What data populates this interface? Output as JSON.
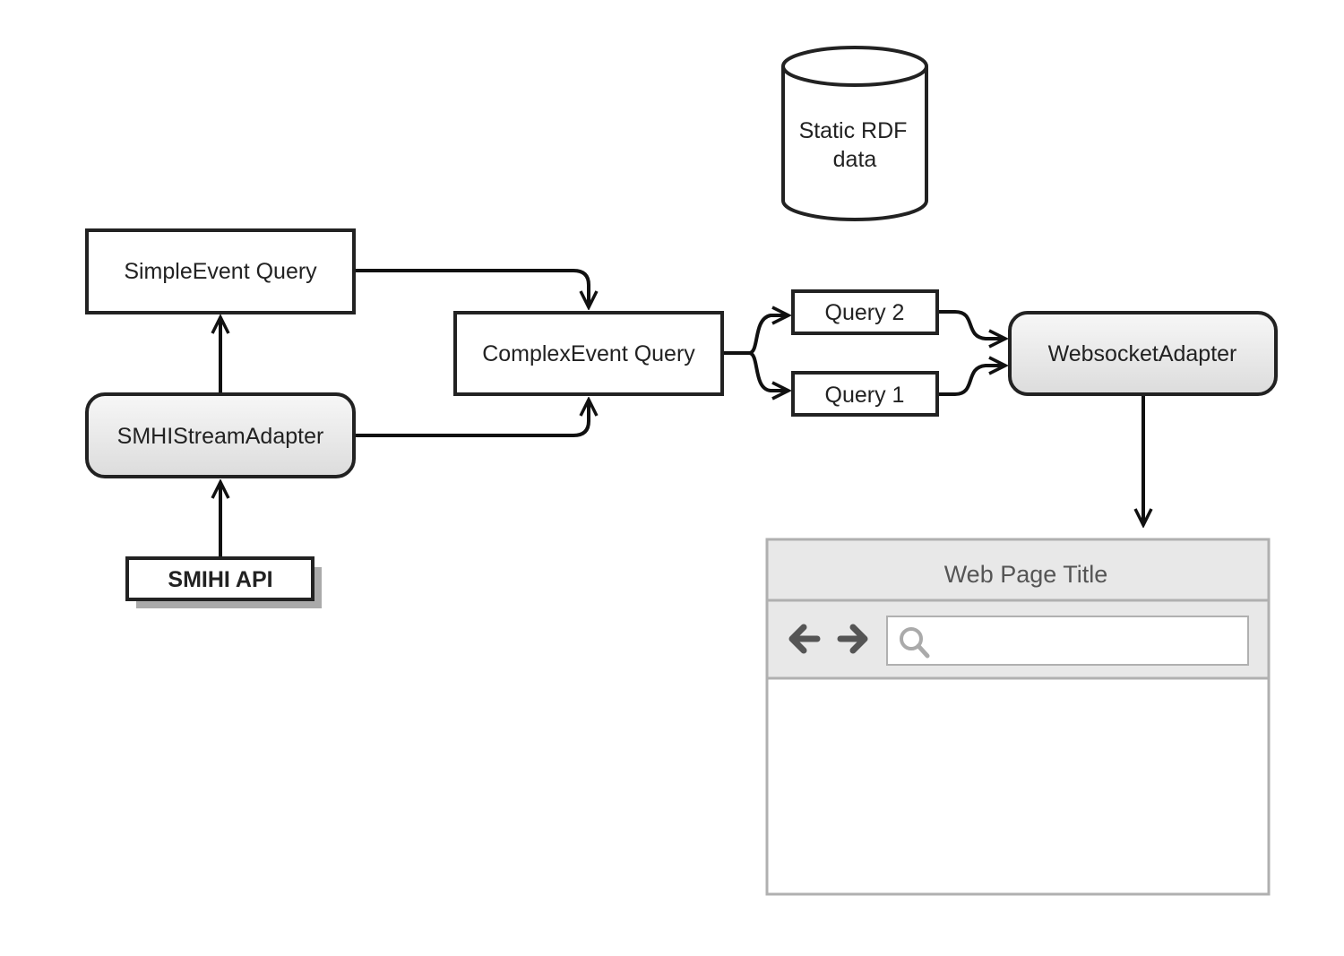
{
  "nodes": {
    "static_rdf": {
      "line1": "Static RDF",
      "line2": "data"
    },
    "simple_event_query": "SimpleEvent Query",
    "smhi_stream_adapter": "SMHIStreamAdapter",
    "smihi_api": "SMIHI API",
    "complex_event_query": "ComplexEvent Query",
    "query2": "Query 2",
    "query1": "Query 1",
    "websocket_adapter": "WebsocketAdapter"
  },
  "browser": {
    "title": "Web Page Title",
    "back_icon": "arrow-left-icon",
    "forward_icon": "arrow-right-icon",
    "search_icon": "search-icon",
    "search_value": ""
  },
  "edges": [
    {
      "from": "SMIHI API",
      "to": "SMHIStreamAdapter"
    },
    {
      "from": "SMHIStreamAdapter",
      "to": "SimpleEvent Query"
    },
    {
      "from": "SMHIStreamAdapter",
      "to": "ComplexEvent Query"
    },
    {
      "from": "SimpleEvent Query",
      "to": "ComplexEvent Query"
    },
    {
      "from": "ComplexEvent Query",
      "to": "Query 2"
    },
    {
      "from": "ComplexEvent Query",
      "to": "Query 1"
    },
    {
      "from": "Query 2",
      "to": "WebsocketAdapter"
    },
    {
      "from": "Query 1",
      "to": "WebsocketAdapter"
    },
    {
      "from": "WebsocketAdapter",
      "to": "Web Page Title"
    }
  ],
  "colors": {
    "stroke": "#222222",
    "adapter_fill": "#e8e8e8",
    "browser_frame": "#b0b0b0",
    "browser_fill": "#e8e8e8"
  }
}
